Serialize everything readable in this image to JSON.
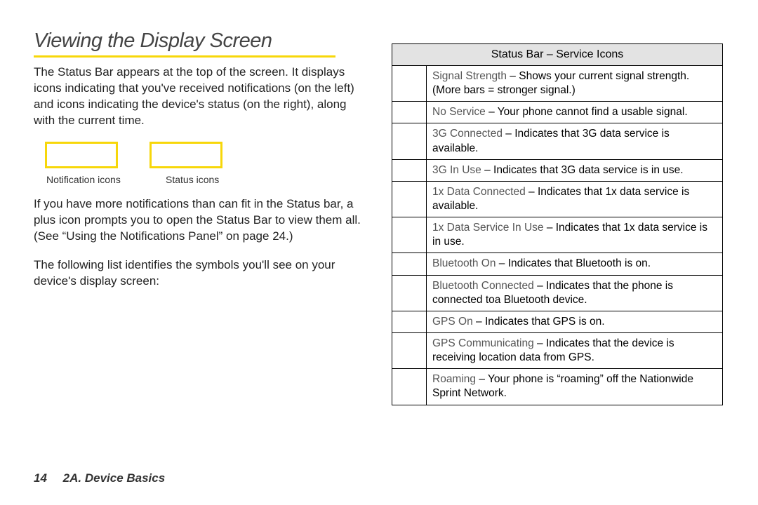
{
  "title": "Viewing the Display Screen",
  "intro": "The Status Bar appears at the top of the screen. It displays icons indicating that you've received notifications (on the left) and icons indicating the device's status (on the right), along with the current time.",
  "diagram": {
    "left_label": "Notification icons",
    "right_label": "Status icons"
  },
  "para2": "If you have more notifications than can fit in the Status bar, a plus icon prompts you to open the Status Bar to view them all. (See “Using the Notifications Panel” on page 24.)",
  "para3": "The following list identifies the symbols you'll see on your device's display screen:",
  "table": {
    "header": "Status Bar – Service Icons",
    "rows": [
      {
        "term": "Signal Strength",
        "sep": " – ",
        "desc": "Shows your current signal strength. (More bars = stronger signal.)"
      },
      {
        "term": "No Service",
        "sep": " – ",
        "desc": "Your phone cannot find a usable signal."
      },
      {
        "term": "3G Connected",
        "sep": " – ",
        "desc": "Indicates that 3G data service is available."
      },
      {
        "term": "3G In Use",
        "sep": " – ",
        "desc": "Indicates that 3G data service is in use."
      },
      {
        "term": "1x Data Connected",
        "sep": " – ",
        "desc": "Indicates that 1x data service is available."
      },
      {
        "term": "1x Data Service In Use",
        "sep": " – ",
        "desc": "Indicates that 1x data service is in use."
      },
      {
        "term": "Bluetooth On",
        "sep": " – ",
        "desc": "Indicates that Bluetooth is on."
      },
      {
        "term": "Bluetooth Connected",
        "sep": " – ",
        "desc": "Indicates that the phone is connected toa Bluetooth device."
      },
      {
        "term": "GPS On",
        "sep": " – ",
        "desc": "Indicates that GPS is on."
      },
      {
        "term": "GPS Communicating",
        "sep": " – ",
        "desc": "Indicates that the device is receiving location data from GPS."
      },
      {
        "term": "Roaming",
        "sep": " – ",
        "desc": "Your phone is “roaming” off the Nationwide Sprint Network."
      }
    ]
  },
  "footer": {
    "page_number": "14",
    "section": "2A. Device Basics"
  }
}
